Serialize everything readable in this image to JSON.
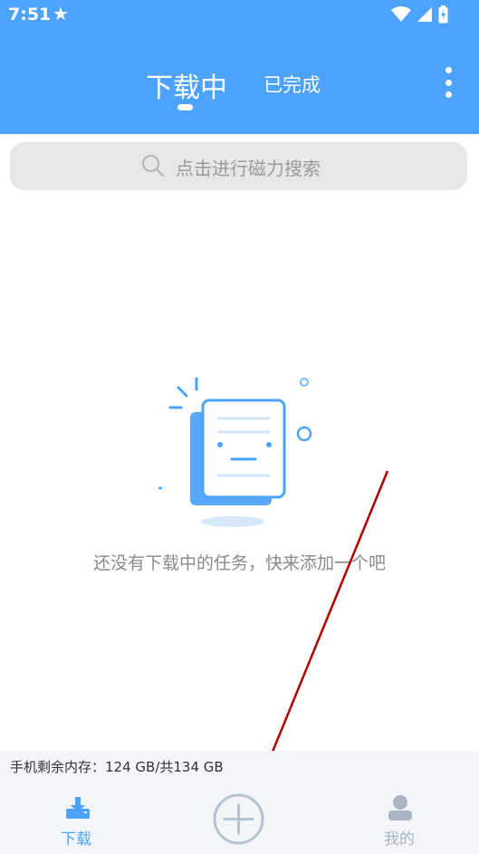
{
  "status_bar": {
    "time": "7:51",
    "star_icon": "★"
  },
  "header": {
    "tab_active": "下载中",
    "tab_inactive": "已完成",
    "more_icon": "more-vertical"
  },
  "search": {
    "placeholder": "点击进行磁力搜索",
    "icon": "search-icon"
  },
  "empty_state": {
    "message": "还没有下载中的任务，快来添加一个吧"
  },
  "storage": {
    "text": "手机剩余内存：124 GB/共134 GB"
  },
  "bottom_nav": {
    "download_label": "下载",
    "mine_label": "我的"
  },
  "colors": {
    "primary": "#4da3fc",
    "inactive": "#aab4c2",
    "annotation": "#b00000"
  }
}
